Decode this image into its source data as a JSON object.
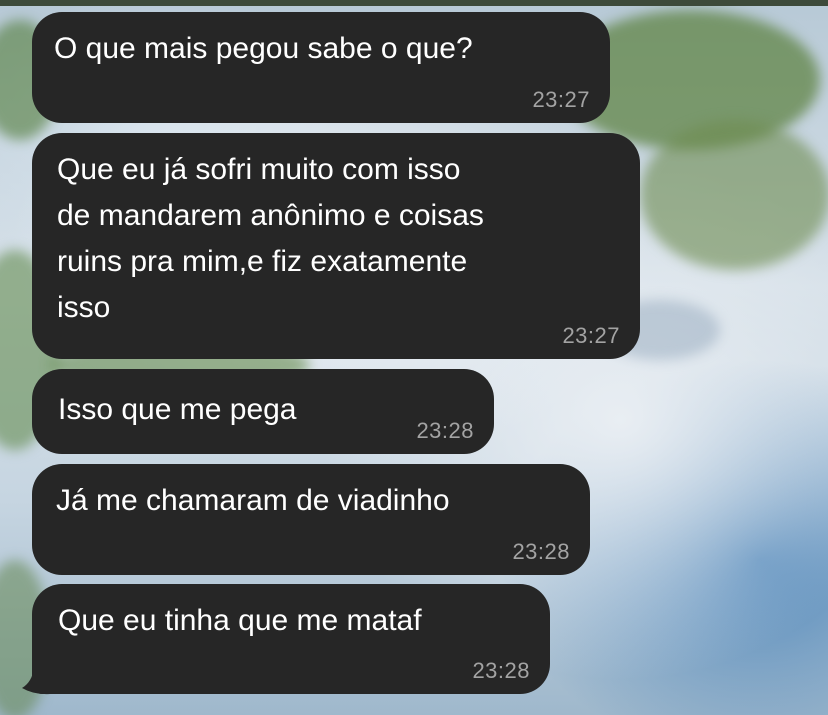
{
  "messages": [
    {
      "text": "O que mais pegou sabe o que?",
      "time": "23:27"
    },
    {
      "text": "Que eu já sofri muito com isso\nde mandarem anônimo e coisas\nruins pra mim,e fiz exatamente\nisso",
      "time": "23:27"
    },
    {
      "text": "Isso que me pega",
      "time": "23:28"
    },
    {
      "text": "Já me chamaram de viadinho",
      "time": "23:28"
    },
    {
      "text": "Que eu tinha que me mataf",
      "time": "23:28"
    }
  ],
  "colors": {
    "bubble": "#262626",
    "text": "#ffffff",
    "time": "#a3a3a3"
  }
}
